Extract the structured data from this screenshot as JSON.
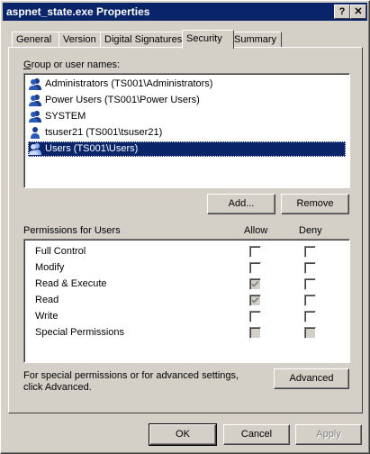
{
  "window": {
    "title": "aspnet_state.exe Properties",
    "help_btn": "?",
    "close_btn": "✕"
  },
  "tabs": [
    {
      "label": "General"
    },
    {
      "label": "Version"
    },
    {
      "label": "Digital Signatures"
    },
    {
      "label": "Security",
      "active": true
    },
    {
      "label": "Summary"
    }
  ],
  "users_group": {
    "label": "Group or user names:",
    "items": [
      {
        "label": "Administrators (TS001\\Administrators)",
        "icon": "group-icon"
      },
      {
        "label": "Power Users (TS001\\Power Users)",
        "icon": "group-icon"
      },
      {
        "label": "SYSTEM",
        "icon": "group-icon"
      },
      {
        "label": "tsuser21 (TS001\\tsuser21)",
        "icon": "user-icon"
      },
      {
        "label": "Users (TS001\\Users)",
        "icon": "group-icon",
        "selected": true
      }
    ],
    "add_label": "Add...",
    "remove_label": "Remove"
  },
  "permissions": {
    "label": "Permissions for Users",
    "allow_header": "Allow",
    "deny_header": "Deny",
    "rows": [
      {
        "name": "Full Control",
        "allow": "unchecked",
        "deny": "unchecked"
      },
      {
        "name": "Modify",
        "allow": "unchecked",
        "deny": "unchecked"
      },
      {
        "name": "Read & Execute",
        "allow": "checked-grey",
        "deny": "unchecked"
      },
      {
        "name": "Read",
        "allow": "checked-grey",
        "deny": "unchecked"
      },
      {
        "name": "Write",
        "allow": "unchecked",
        "deny": "unchecked"
      },
      {
        "name": "Special Permissions",
        "allow": "grey",
        "deny": "grey"
      }
    ]
  },
  "advanced": {
    "text_line1": "For special permissions or for advanced settings,",
    "text_line2": "click Advanced.",
    "button_label": "Advanced"
  },
  "footer": {
    "ok": "OK",
    "cancel": "Cancel",
    "apply": "Apply"
  },
  "colors": {
    "face": "#d4d0c8",
    "title_bg": "#0a246a",
    "selection": "#0a246a"
  }
}
